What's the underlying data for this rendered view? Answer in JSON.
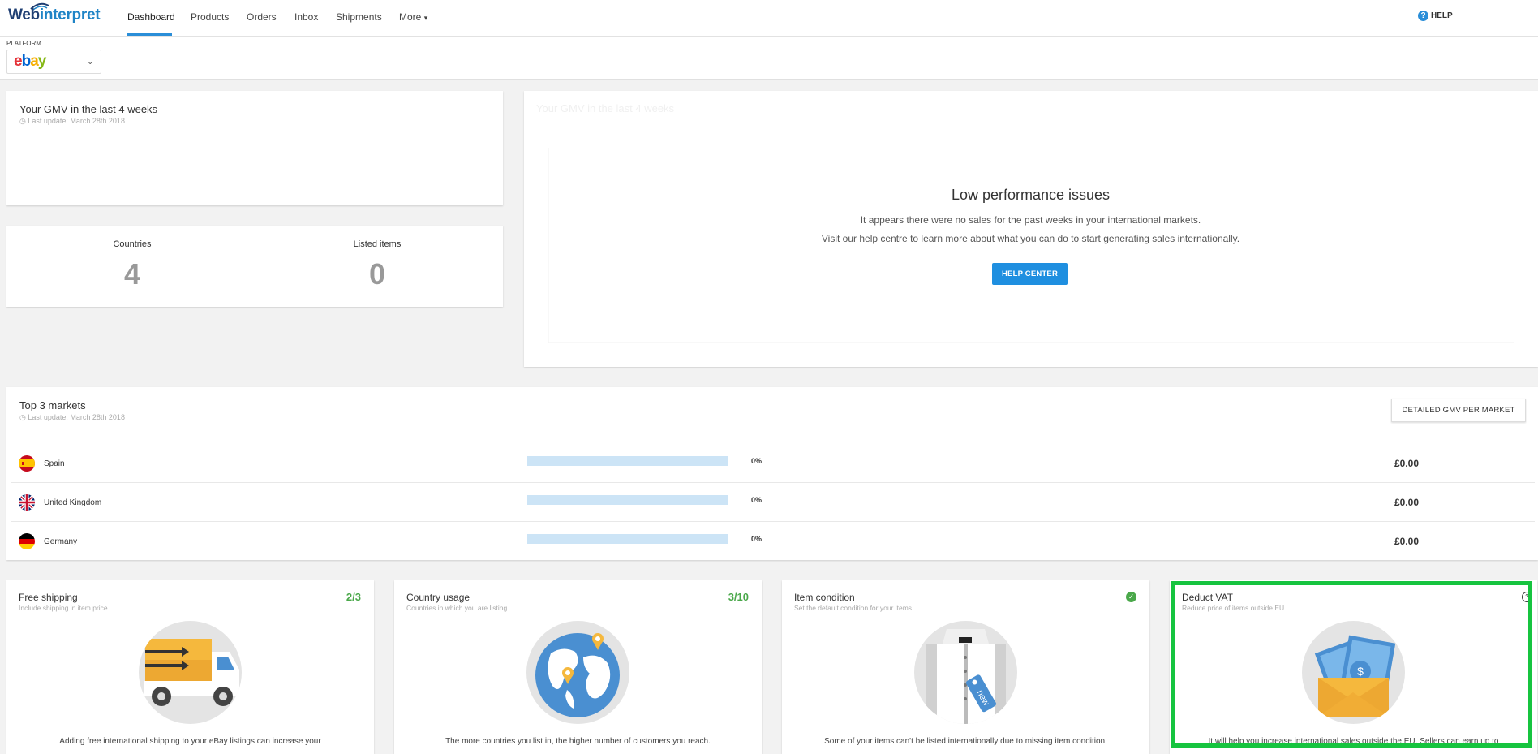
{
  "nav": {
    "logo_dark": "Web",
    "logo_accent": "interpret",
    "items": [
      "Dashboard",
      "Products",
      "Orders",
      "Inbox",
      "Shipments",
      "More"
    ],
    "more_caret": "▾",
    "help_label": "HELP",
    "help_icon": "?"
  },
  "platform": {
    "label": "PLATFORM",
    "selected": "ebay",
    "chevron": "⌄"
  },
  "gmv_card": {
    "title": "Your GMV in the last 4 weeks",
    "last_update": "Last update: March 28th 2018"
  },
  "stats": {
    "countries_label": "Countries",
    "countries_value": "4",
    "listed_label": "Listed items",
    "listed_value": "0"
  },
  "performance": {
    "ghost_title": "Your GMV in the last 4 weeks",
    "title": "Low performance issues",
    "line1": "It appears there were no sales for the past weeks in your international markets.",
    "line2": "Visit our help centre to learn more about what you can do to start generating sales internationally.",
    "button": "HELP CENTER"
  },
  "markets": {
    "title": "Top 3 markets",
    "last_update": "Last update: March 28th 2018",
    "detail_button": "DETAILED GMV PER MARKET",
    "rows": [
      {
        "name": "Spain",
        "share": 0,
        "pct": "0%",
        "amount": "£0.00",
        "flag": "es-flag-icon"
      },
      {
        "name": "United Kingdom",
        "share": 0,
        "pct": "0%",
        "amount": "£0.00",
        "flag": "uk-flag-icon"
      },
      {
        "name": "Germany",
        "share": 0,
        "pct": "0%",
        "amount": "£0.00",
        "flag": "de-flag-icon"
      }
    ]
  },
  "cards": [
    {
      "title": "Free shipping",
      "sub": "Include shipping in item price",
      "score": "2/3",
      "desc": "Adding free international shipping to your eBay listings can increase your",
      "icon": "truck-icon"
    },
    {
      "title": "Country usage",
      "sub": "Countries in which you are listing",
      "score": "3/10",
      "desc": "The more countries you list in, the higher number of customers you reach.",
      "icon": "globe-icon"
    },
    {
      "title": "Item condition",
      "sub": "Set the default condition for your items",
      "score": "",
      "tag": "new",
      "desc": "Some of your items can't be listed internationally due to missing item condition.",
      "icon": "shirt-icon"
    },
    {
      "title": "Deduct VAT",
      "sub": "Reduce price of items outside EU",
      "score": "",
      "desc": "It will help you increase international sales outside the EU. Sellers can earn up to",
      "icon": "envelope-money-icon"
    }
  ],
  "colors": {
    "accent": "#2a8ed8",
    "button": "#1f8fe0",
    "success": "#4aa84a",
    "highlight": "#16c43f",
    "bar": "#cce4f6"
  }
}
